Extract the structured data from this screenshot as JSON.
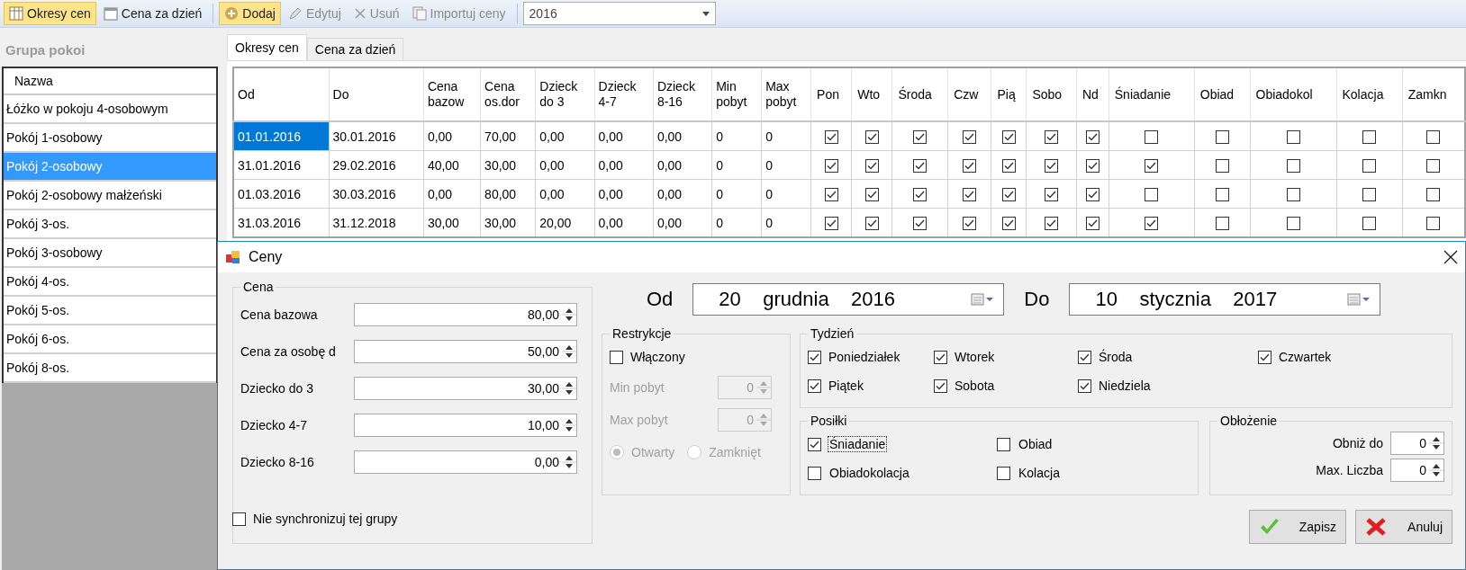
{
  "toolbar": {
    "items": [
      {
        "label": "Okresy cen",
        "selected": true,
        "disabled": false
      },
      {
        "label": "Cena za dzień",
        "selected": false,
        "disabled": false
      },
      {
        "label": "Dodaj",
        "selected": true,
        "disabled": false
      },
      {
        "label": "Edytuj",
        "selected": false,
        "disabled": true
      },
      {
        "label": "Usuń",
        "selected": false,
        "disabled": true
      },
      {
        "label": "Importuj ceny",
        "selected": false,
        "disabled": true
      }
    ],
    "year": "2016"
  },
  "sidebar": {
    "title": "Grupa pokoi",
    "header": "Nazwa",
    "items": [
      {
        "label": "Łóżko w pokoju 4-osobowym",
        "selected": false
      },
      {
        "label": "Pokój 1-osobowy",
        "selected": false
      },
      {
        "label": "Pokój 2-osobowy",
        "selected": true
      },
      {
        "label": "Pokój 2-osobowy małżeński",
        "selected": false
      },
      {
        "label": "Pokój 3-os.",
        "selected": false
      },
      {
        "label": "Pokój 3-osobowy",
        "selected": false
      },
      {
        "label": "Pokój 4-os.",
        "selected": false
      },
      {
        "label": "Pokój 5-os.",
        "selected": false
      },
      {
        "label": "Pokój 6-os.",
        "selected": false
      },
      {
        "label": "Pokój 8-os.",
        "selected": false
      }
    ]
  },
  "tabs": [
    {
      "label": "Okresy cen",
      "selected": true
    },
    {
      "label": "Cena za dzień",
      "selected": false
    }
  ],
  "table": {
    "columns": [
      {
        "label": "Od",
        "kind": "text"
      },
      {
        "label": "Do",
        "kind": "text"
      },
      {
        "label": "Cena\nbazow",
        "kind": "text"
      },
      {
        "label": "Cena\nos.dor",
        "kind": "text"
      },
      {
        "label": "Dzieck\ndo 3",
        "kind": "text"
      },
      {
        "label": "Dzieck\n4-7",
        "kind": "text"
      },
      {
        "label": "Dzieck\n8-16",
        "kind": "text"
      },
      {
        "label": "Min\npobyt",
        "kind": "text"
      },
      {
        "label": "Max\npobyt",
        "kind": "text"
      },
      {
        "label": "Pon",
        "kind": "check"
      },
      {
        "label": "Wto",
        "kind": "check"
      },
      {
        "label": "Środa",
        "kind": "check"
      },
      {
        "label": "Czw",
        "kind": "check"
      },
      {
        "label": "Pią",
        "kind": "check"
      },
      {
        "label": "Sobo",
        "kind": "check"
      },
      {
        "label": "Nd",
        "kind": "check"
      },
      {
        "label": "Śniadanie",
        "kind": "check"
      },
      {
        "label": "Obiad",
        "kind": "check"
      },
      {
        "label": "Obiadokol",
        "kind": "check"
      },
      {
        "label": "Kolacja",
        "kind": "check"
      },
      {
        "label": "Zamkn",
        "kind": "check"
      }
    ],
    "rows": [
      {
        "selected": true,
        "cells": [
          "01.01.2016",
          "30.01.2016",
          "0,00",
          "70,00",
          "0,00",
          "0,00",
          "0,00",
          "0",
          "0",
          true,
          true,
          true,
          true,
          true,
          true,
          true,
          false,
          false,
          false,
          false,
          false
        ]
      },
      {
        "selected": false,
        "cells": [
          "31.01.2016",
          "29.02.2016",
          "40,00",
          "30,00",
          "0,00",
          "0,00",
          "0,00",
          "0",
          "0",
          true,
          true,
          true,
          true,
          true,
          true,
          true,
          true,
          false,
          false,
          false,
          false
        ]
      },
      {
        "selected": false,
        "cells": [
          "01.03.2016",
          "30.03.2016",
          "0,00",
          "80,00",
          "0,00",
          "0,00",
          "0,00",
          "0",
          "0",
          true,
          true,
          true,
          true,
          true,
          true,
          true,
          false,
          false,
          false,
          false,
          false
        ]
      },
      {
        "selected": false,
        "cells": [
          "31.03.2016",
          "31.12.2018",
          "30,00",
          "30,00",
          "20,00",
          "0,00",
          "0,00",
          "0",
          "0",
          true,
          true,
          true,
          true,
          true,
          true,
          true,
          true,
          false,
          false,
          false,
          false
        ]
      }
    ]
  },
  "dialog": {
    "title": "Ceny",
    "price": {
      "title": "Cena",
      "fields": [
        {
          "label": "Cena bazowa",
          "value": "80,00"
        },
        {
          "label": "Cena za osobę d",
          "value": "50,00"
        },
        {
          "label": "Dziecko do 3",
          "value": "30,00"
        },
        {
          "label": "Dziecko 4-7",
          "value": "10,00"
        },
        {
          "label": "Dziecko 8-16",
          "value": "0,00"
        }
      ]
    },
    "from": {
      "label": "Od",
      "day": "20",
      "month": "grudnia",
      "year": "2016"
    },
    "to": {
      "label": "Do",
      "day": "10",
      "month": "stycznia",
      "year": "2017"
    },
    "restrictions": {
      "title": "Restrykcje",
      "disabled": true,
      "enabled": {
        "label": "Włączony",
        "checked": false
      },
      "fields": [
        {
          "label": "Min pobyt",
          "value": "0"
        },
        {
          "label": "Max pobyt",
          "value": "0"
        }
      ],
      "radios": [
        {
          "label": "Otwarty",
          "selected": true
        },
        {
          "label": "Zamknięt",
          "selected": false
        }
      ]
    },
    "week": {
      "title": "Tydzień",
      "days": [
        {
          "label": "Poniedziałek",
          "checked": true
        },
        {
          "label": "Wtorek",
          "checked": true
        },
        {
          "label": "Środa",
          "checked": true
        },
        {
          "label": "Czwartek",
          "checked": true
        },
        {
          "label": "Piątek",
          "checked": true
        },
        {
          "label": "Sobota",
          "checked": true
        },
        {
          "label": "Niedziela",
          "checked": true
        }
      ]
    },
    "meals": {
      "title": "Posiłki",
      "items": [
        {
          "label": "Śniadanie",
          "checked": true,
          "focused": true
        },
        {
          "label": "Obiad",
          "checked": false,
          "focused": false
        },
        {
          "label": "Obiadokolacja",
          "checked": false,
          "focused": false
        },
        {
          "label": "Kolacja",
          "checked": false,
          "focused": false
        }
      ]
    },
    "occupancy": {
      "title": "Obłożenie",
      "fields": [
        {
          "label": "Obniż do",
          "value": "0"
        },
        {
          "label": "Max. Liczba",
          "value": "0"
        }
      ]
    },
    "sync": {
      "label": "Nie synchronizuj tej grupy",
      "checked": false
    },
    "buttons": [
      {
        "label": "Zapisz",
        "kind": "ok"
      },
      {
        "label": "Anuluj",
        "kind": "cancel"
      }
    ]
  }
}
